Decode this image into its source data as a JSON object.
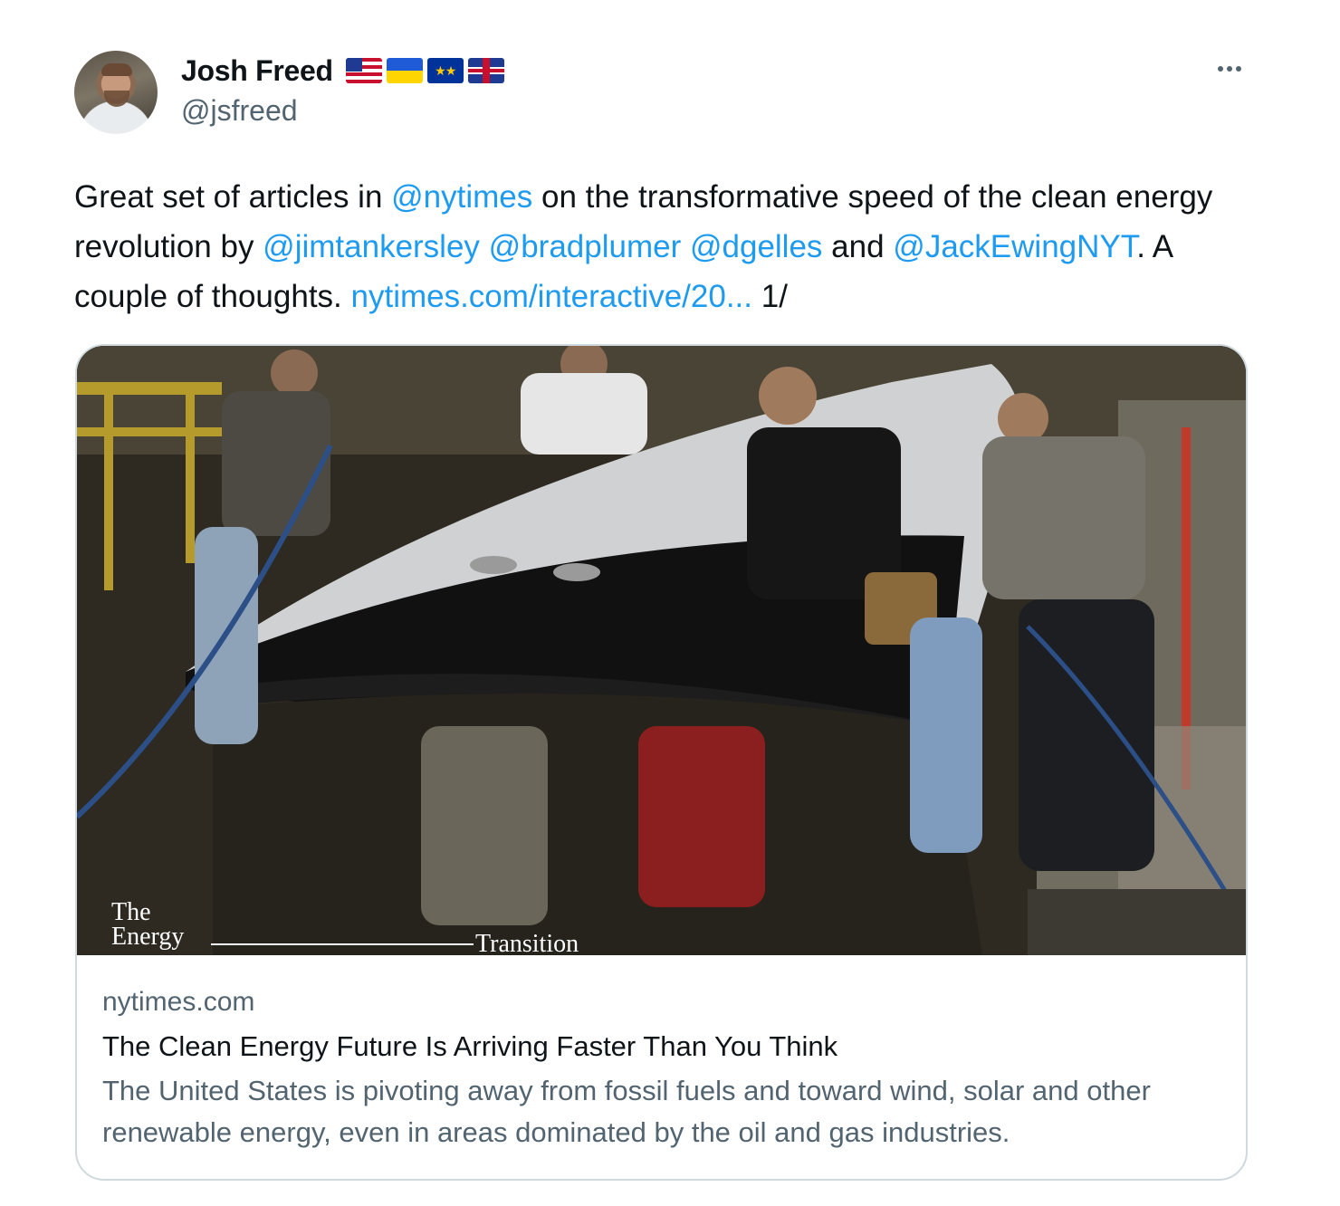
{
  "author": {
    "display_name": "Josh Freed",
    "flags": [
      "us-flag",
      "ukraine-flag",
      "eu-flag",
      "uk-flag"
    ],
    "handle": "@jsfreed"
  },
  "tweet": {
    "segments": [
      {
        "text": "Great set of articles in ",
        "type": "text"
      },
      {
        "text": "@nytimes",
        "type": "mention"
      },
      {
        "text": " on the transformative speed of the clean energy revolution by ",
        "type": "text"
      },
      {
        "text": "@jimtankersley",
        "type": "mention"
      },
      {
        "text": " ",
        "type": "text"
      },
      {
        "text": "@bradplumer",
        "type": "mention"
      },
      {
        "text": " ",
        "type": "text"
      },
      {
        "text": "@dgelles",
        "type": "mention"
      },
      {
        "text": " and ",
        "type": "text"
      },
      {
        "text": "@JackEwingNYT",
        "type": "mention"
      },
      {
        "text": ". A couple of thoughts. ",
        "type": "text"
      },
      {
        "text": "nytimes.com/interactive/20...",
        "type": "link"
      },
      {
        "text": " 1/",
        "type": "text"
      }
    ]
  },
  "card": {
    "image_overlay": {
      "line1": "The",
      "line2": "Energy",
      "line3": "Transition"
    },
    "domain": "nytimes.com",
    "title": "The Clean Energy Future Is Arriving Faster Than You Think",
    "description": "The United States is pivoting away from fossil fuels and toward wind, solar and other renewable energy, even in areas dominated by the oil and gas industries."
  },
  "colors": {
    "link": "#1d9bf0",
    "secondary_text": "#536471",
    "primary_text": "#0f1419",
    "card_border": "#cfd9de"
  }
}
